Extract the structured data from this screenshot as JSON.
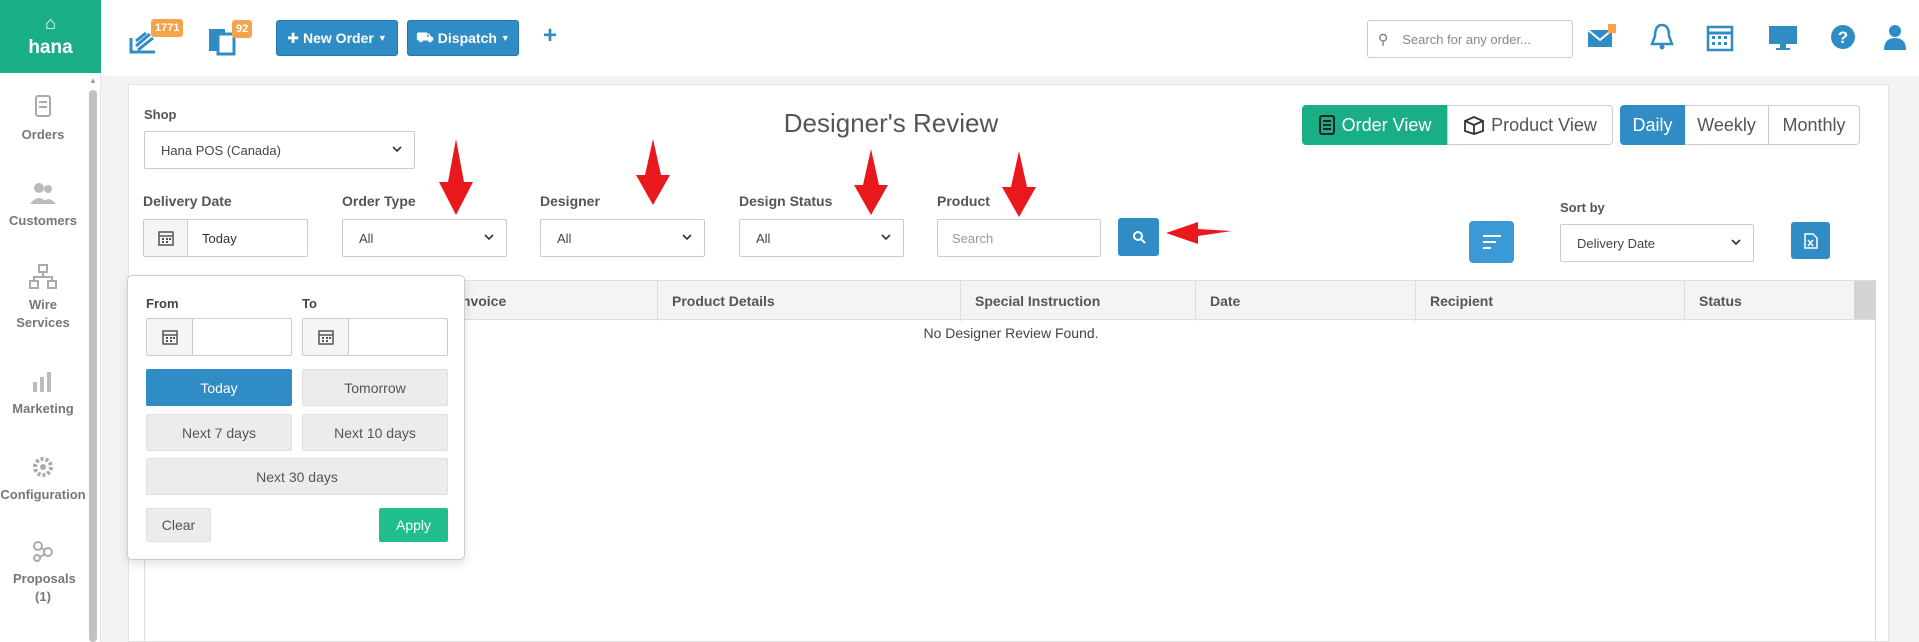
{
  "brand": {
    "name": "hana"
  },
  "sidebar": {
    "items": [
      {
        "label": "Orders"
      },
      {
        "label": "Customers"
      },
      {
        "label": "Wire Services"
      },
      {
        "label": "Marketing"
      },
      {
        "label": "Configuration"
      },
      {
        "label": "Proposals (1)"
      }
    ]
  },
  "topbar": {
    "orders_badge": "1771",
    "pages_badge": "92",
    "new_order_label": "New Order",
    "dispatch_label": "Dispatch",
    "search_placeholder": "Search for any order..."
  },
  "page": {
    "title": "Designer's Review",
    "shop_label": "Shop",
    "shop_value": "Hana POS (Canada)",
    "view_toggle": {
      "order_view": "Order View",
      "product_view": "Product View"
    },
    "period_toggle": {
      "daily": "Daily",
      "weekly": "Weekly",
      "monthly": "Monthly"
    }
  },
  "filters": {
    "delivery_date_label": "Delivery Date",
    "delivery_date_value": "Today",
    "order_type_label": "Order Type",
    "order_type_value": "All",
    "designer_label": "Designer",
    "designer_value": "All",
    "design_status_label": "Design Status",
    "design_status_value": "All",
    "product_label": "Product",
    "product_placeholder": "Search",
    "sort_by_label": "Sort by",
    "sort_by_value": "Delivery Date"
  },
  "table": {
    "columns": [
      "Invoice",
      "Product Details",
      "Special Instruction",
      "Date",
      "Recipient",
      "Status"
    ],
    "empty_message": "No Designer Review Found."
  },
  "date_popup": {
    "from_label": "From",
    "to_label": "To",
    "today": "Today",
    "tomorrow": "Tomorrow",
    "next7": "Next 7 days",
    "next10": "Next 10 days",
    "next30": "Next 30 days",
    "clear": "Clear",
    "apply": "Apply"
  },
  "colors": {
    "brand_green": "#1aae86",
    "primary_blue": "#2f8cc4",
    "badge_orange": "#f5a44c",
    "arrow_red": "#e8181c"
  }
}
